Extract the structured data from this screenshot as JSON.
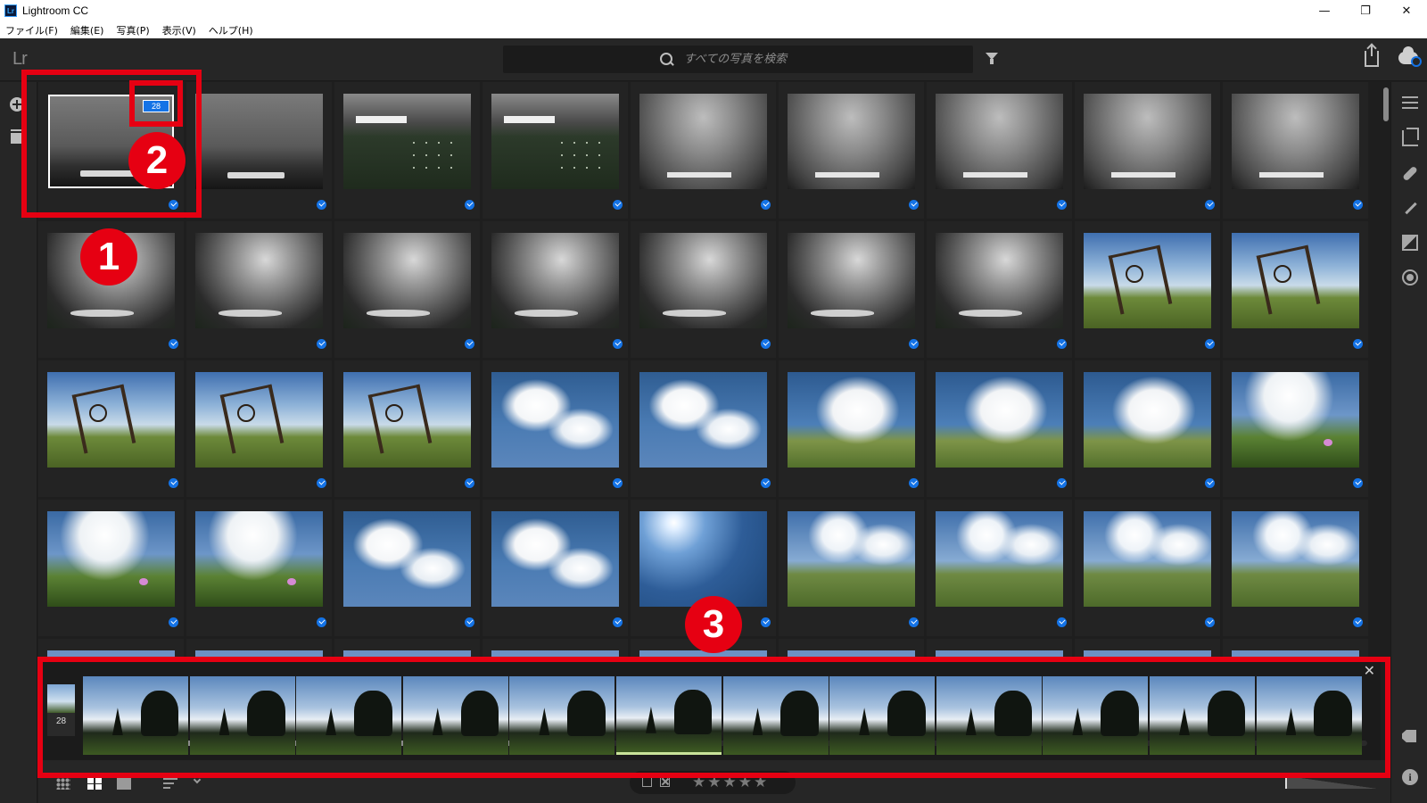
{
  "window": {
    "title": "Lightroom CC",
    "app_badge": "Lr",
    "controls": {
      "minimize": "—",
      "maximize": "❐",
      "close": "✕"
    }
  },
  "menu": [
    "ファイル(F)",
    "編集(E)",
    "写真(P)",
    "表示(V)",
    "ヘルプ(H)"
  ],
  "toolbar": {
    "logo": "Lr",
    "search_placeholder": "すべての写真を検索"
  },
  "grid": {
    "rows": [
      [
        "fog-selected",
        "fog",
        "fogplant",
        "fogplant",
        "fog-bright",
        "fog-bright",
        "fog-bright",
        "fog-bright",
        "fog-bright"
      ],
      [
        "storm",
        "storm",
        "storm",
        "storm",
        "storm",
        "storm",
        "storm",
        "gate",
        "gate"
      ],
      [
        "gate",
        "gate",
        "gate",
        "cloud",
        "cloud",
        "cloudfield",
        "cloudfield",
        "cloudfield",
        "flower"
      ],
      [
        "flower",
        "flower",
        "cloud",
        "cloud",
        "sun",
        "hills",
        "hills",
        "hills",
        "hills"
      ],
      [
        "partial",
        "partial",
        "partial",
        "partial",
        "partial",
        "partial",
        "partial",
        "partial",
        "partial"
      ]
    ],
    "selected_stack_count": "28"
  },
  "filmstrip": {
    "stack_count": "28",
    "item_count": 12,
    "active_index": 5,
    "close_label": "✕"
  },
  "bottombar": {
    "stars": "★★★★★"
  },
  "annotations": {
    "badge1": "1",
    "badge2": "2",
    "badge3": "3"
  },
  "colors": {
    "accent": "#1473e6",
    "annotation_red": "#e60012",
    "background": "#1e1e1e",
    "panel": "#262626"
  }
}
